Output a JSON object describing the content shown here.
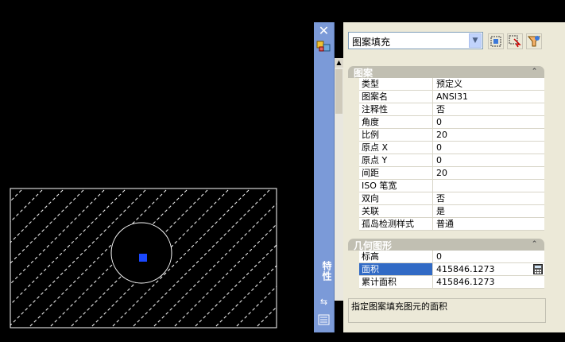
{
  "drawing": {
    "hatch_color": "#ffffff",
    "background_color": "#000000",
    "grip_color": "#1a48ff"
  },
  "palette": {
    "vertical_title": "特性",
    "close_icon": "close-icon",
    "object_selector": {
      "value": "图案填充"
    },
    "toolbar_icons": [
      "quick-select-icon",
      "select-objects-icon",
      "toggle-pickadd-icon"
    ],
    "sections": [
      {
        "title": "图案",
        "rows": [
          {
            "label": "类型",
            "value": "预定义"
          },
          {
            "label": "图案名",
            "value": "ANSI31"
          },
          {
            "label": "注释性",
            "value": "否"
          },
          {
            "label": "角度",
            "value": "0"
          },
          {
            "label": "比例",
            "value": "20"
          },
          {
            "label": "原点 X",
            "value": "0"
          },
          {
            "label": "原点 Y",
            "value": "0"
          },
          {
            "label": "间距",
            "value": "20"
          },
          {
            "label": "ISO 笔宽",
            "value": ""
          },
          {
            "label": "双向",
            "value": "否"
          },
          {
            "label": "关联",
            "value": "是"
          },
          {
            "label": "孤岛检测样式",
            "value": "普通"
          }
        ]
      },
      {
        "title": "几何图形",
        "rows": [
          {
            "label": "标高",
            "value": "0"
          },
          {
            "label": "面积",
            "value": "415846.1273"
          },
          {
            "label": "累计面积",
            "value": "415846.1273"
          }
        ]
      }
    ],
    "selected_row": "面积",
    "description": "指定图案填充图元的面积",
    "accent_color": "#316ac5",
    "titlebar_color": "#7b9ad8"
  }
}
